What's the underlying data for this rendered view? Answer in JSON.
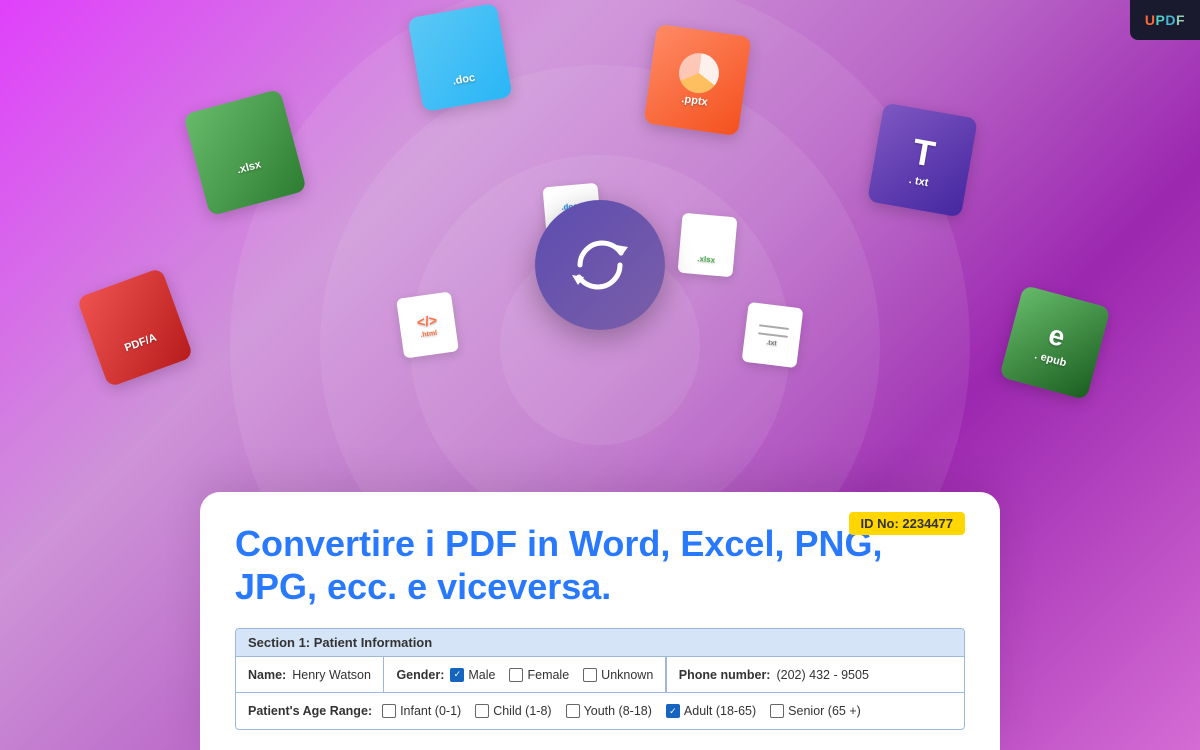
{
  "app": {
    "logo": "UPDF",
    "logo_parts": [
      "U",
      "P",
      "D",
      "F"
    ]
  },
  "hero": {
    "title": "Convertire i PDF in Word, Excel, PNG, JPG, ecc. e viceversa.",
    "id_badge": "ID No: 2234477",
    "convert_icon": "⟳"
  },
  "file_icons": [
    {
      "name": ".doc",
      "color": "blue",
      "position": "top-center-left"
    },
    {
      "name": ".pptx",
      "color": "orange",
      "position": "top-center-right"
    },
    {
      "name": ".xlsx",
      "color": "green",
      "position": "left-mid"
    },
    {
      "name": ".txt",
      "color": "purple",
      "position": "right-mid"
    },
    {
      "name": "PDF/A",
      "color": "red",
      "position": "left-far"
    },
    {
      "name": ".epub",
      "color": "green-dark",
      "position": "right-far"
    },
    {
      "name": ".docx",
      "color": "white",
      "position": "small-center-left"
    },
    {
      "name": ".xlsx",
      "color": "white",
      "position": "small-center-right"
    },
    {
      "name": ".html",
      "color": "white",
      "position": "small-left"
    },
    {
      "name": ".txt",
      "color": "white",
      "position": "small-right"
    }
  ],
  "patient_form": {
    "section_label": "Section 1: Patient Information",
    "name_label": "Name:",
    "name_value": "Henry Watson",
    "gender_label": "Gender:",
    "gender_options": [
      {
        "label": "Male",
        "checked": true
      },
      {
        "label": "Female",
        "checked": false
      },
      {
        "label": "Unknown",
        "checked": false
      }
    ],
    "phone_label": "Phone number:",
    "phone_value": "(202) 432 - 9505",
    "age_label": "Patient's Age Range:",
    "age_options": [
      {
        "label": "Infant (0-1)",
        "checked": false
      },
      {
        "label": "Child (1-8)",
        "checked": false
      },
      {
        "label": "Youth (8-18)",
        "checked": false
      },
      {
        "label": "Adult (18-65)",
        "checked": true
      },
      {
        "label": "Senior (65 +)",
        "checked": false
      }
    ]
  }
}
